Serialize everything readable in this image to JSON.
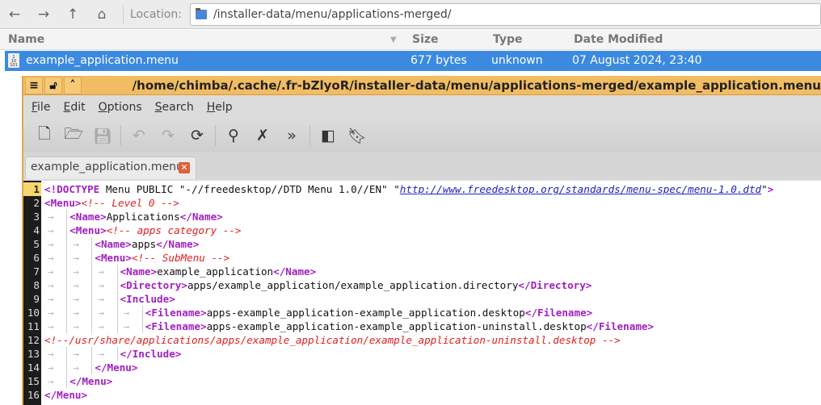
{
  "filemanager": {
    "location_label": "Location:",
    "path": "/installer-data/menu/applications-merged/",
    "columns": [
      "Name",
      "Size",
      "Type",
      "Date Modified"
    ],
    "file": {
      "name": "example_application.menu",
      "size": "677 bytes",
      "type": "unknown",
      "modified": "07 August 2024, 23:40"
    }
  },
  "editor": {
    "title": "/home/chimba/.cache/.fr-bZlyoR/installer-data/menu/applications-merged/example_application.menu",
    "menus": [
      "File",
      "Edit",
      "Options",
      "Search",
      "Help"
    ],
    "tab": "example_application.menu",
    "lines": [
      {
        "n": "1",
        "i": 0,
        "tokens": [
          {
            "c": "tag",
            "v": "<!DOCTYPE"
          },
          {
            "c": "tx",
            "v": " Menu PUBLIC \"-//freedesktop//DTD Menu 1.0//EN\" \""
          },
          {
            "c": "lk",
            "v": "http://www.freedesktop.org/standards/menu-spec/menu-1.0.dtd"
          },
          {
            "c": "tx",
            "v": "\""
          },
          {
            "c": "tag",
            "v": ">"
          }
        ]
      },
      {
        "n": "2",
        "i": 0,
        "tokens": [
          {
            "c": "tag",
            "v": "<Menu>"
          },
          {
            "c": "cm",
            "v": "<!-- Level 0 -->"
          }
        ]
      },
      {
        "n": "3",
        "i": 1,
        "tokens": [
          {
            "c": "tag",
            "v": "<Name>"
          },
          {
            "c": "tx",
            "v": "Applications"
          },
          {
            "c": "tag",
            "v": "</Name>"
          }
        ]
      },
      {
        "n": "4",
        "i": 1,
        "tokens": [
          {
            "c": "tag",
            "v": "<Menu>"
          },
          {
            "c": "cm",
            "v": "<!-- apps category -->"
          }
        ]
      },
      {
        "n": "5",
        "i": 2,
        "tokens": [
          {
            "c": "tag",
            "v": "<Name>"
          },
          {
            "c": "tx",
            "v": "apps"
          },
          {
            "c": "tag",
            "v": "</Name>"
          }
        ]
      },
      {
        "n": "6",
        "i": 2,
        "tokens": [
          {
            "c": "tag",
            "v": "<Menu>"
          },
          {
            "c": "cm",
            "v": "<!-- SubMenu -->"
          }
        ]
      },
      {
        "n": "7",
        "i": 3,
        "tokens": [
          {
            "c": "tag",
            "v": "<Name>"
          },
          {
            "c": "tx",
            "v": "example_application"
          },
          {
            "c": "tag",
            "v": "</Name>"
          }
        ]
      },
      {
        "n": "8",
        "i": 3,
        "tokens": [
          {
            "c": "tag",
            "v": "<Directory>"
          },
          {
            "c": "tx",
            "v": "apps/example_application/example_application.directory"
          },
          {
            "c": "tag",
            "v": "</Directory>"
          }
        ]
      },
      {
        "n": "9",
        "i": 3,
        "tokens": [
          {
            "c": "tag",
            "v": "<Include>"
          }
        ]
      },
      {
        "n": "10",
        "i": 4,
        "tokens": [
          {
            "c": "tag",
            "v": "<Filename>"
          },
          {
            "c": "tx",
            "v": "apps-example_application-example_application.desktop"
          },
          {
            "c": "tag",
            "v": "</Filename>"
          }
        ]
      },
      {
        "n": "11",
        "i": 4,
        "tokens": [
          {
            "c": "tag",
            "v": "<Filename>"
          },
          {
            "c": "tx",
            "v": "apps-example_application-example_application-uninstall.desktop"
          },
          {
            "c": "tag",
            "v": "</Filename>"
          }
        ]
      },
      {
        "n": "12",
        "i": 0,
        "tokens": [
          {
            "c": "cm",
            "v": "<!--/usr/share/applications/apps/example_application/example_application-uninstall.desktop -->"
          }
        ]
      },
      {
        "n": "13",
        "i": 3,
        "tokens": [
          {
            "c": "tag",
            "v": "</Include>"
          }
        ]
      },
      {
        "n": "14",
        "i": 2,
        "tokens": [
          {
            "c": "tag",
            "v": "</Menu>"
          }
        ]
      },
      {
        "n": "15",
        "i": 1,
        "tokens": [
          {
            "c": "tag",
            "v": "</Menu>"
          }
        ]
      },
      {
        "n": "16",
        "i": 0,
        "tokens": [
          {
            "c": "tag",
            "v": "</Menu>"
          }
        ]
      }
    ]
  }
}
